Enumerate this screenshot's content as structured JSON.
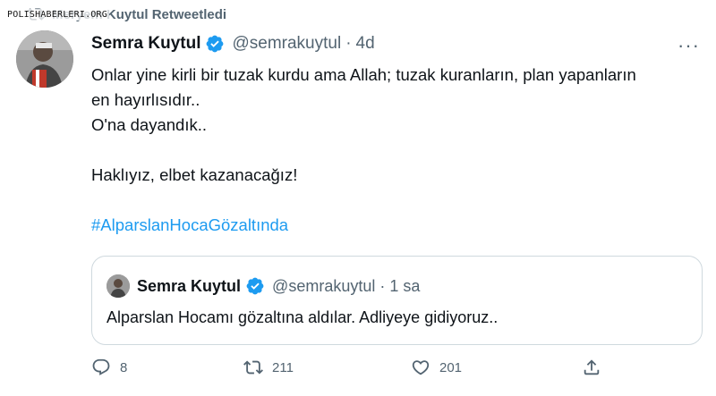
{
  "watermark": "POLISHABERLERI.ORG",
  "retweet": {
    "label": "Meryem Kuytul Retweetledi",
    "icon": "retweet-icon"
  },
  "tweet": {
    "author_name": "Semra Kuytul",
    "handle": "@semrakuytul",
    "separator": "·",
    "time": "4d",
    "more_icon": "···",
    "lines": [
      "Onlar yine kirli bir tuzak kurdu ama Allah; tuzak kuranların, plan yapanların",
      "en hayırlısıdır..",
      "O'na dayandık..",
      "Haklıyız, elbet kazanacağız!"
    ],
    "hashtag": "#AlparslanHocaGözaltında"
  },
  "quote": {
    "author_name": "Semra Kuytul",
    "handle": "@semrakuytul",
    "separator": "·",
    "time": "1 sa",
    "text": "Alparslan Hocamı gözaltına aldılar. Adliyeye gidiyoruz.."
  },
  "actions": {
    "reply_count": "8",
    "retweet_count": "211",
    "like_count": "201"
  },
  "colors": {
    "accent": "#1d9bf0",
    "secondary_text": "#536471",
    "border": "#cfd9de"
  }
}
